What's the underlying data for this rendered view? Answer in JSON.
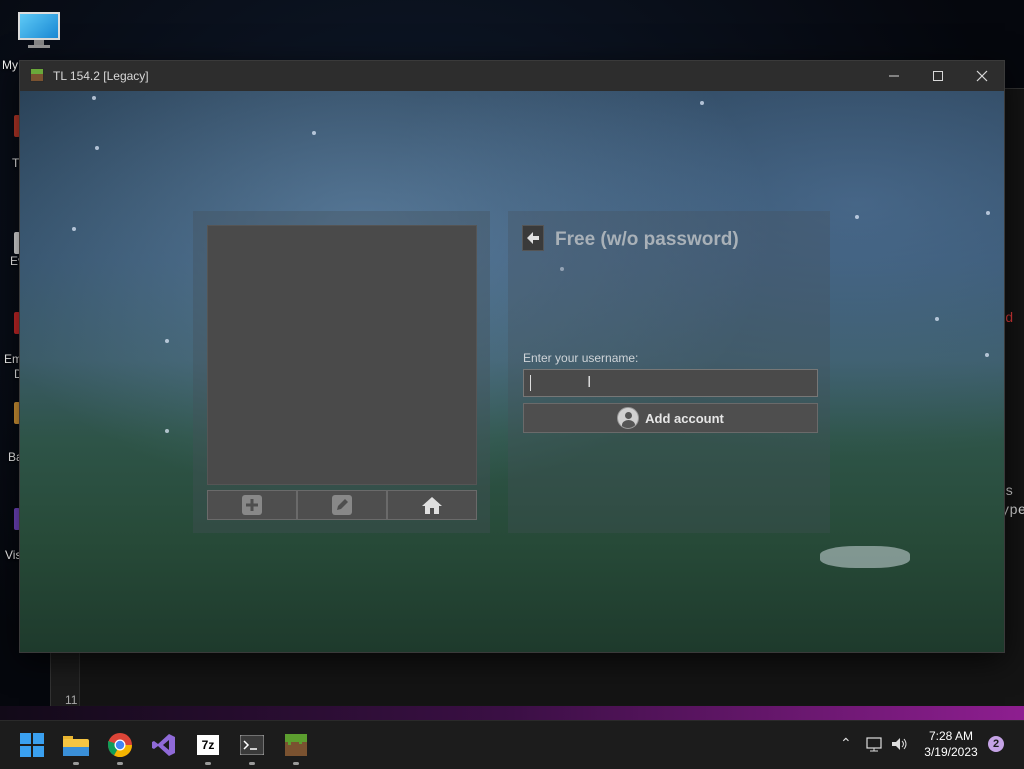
{
  "desktop": {
    "icons": [
      {
        "label": "My"
      },
      {
        "label": "T"
      },
      {
        "label": "Ev"
      },
      {
        "label": "Em"
      },
      {
        "label": "D"
      },
      {
        "label": "Ba"
      },
      {
        "label": "Vis"
      }
    ]
  },
  "background_window": {
    "fragments": [
      "d",
      "s",
      "ype"
    ],
    "line_number": "11"
  },
  "window": {
    "title": "TL 154.2 [Legacy]",
    "controls": {
      "minimize": "minimize",
      "maximize": "maximize",
      "close": "close"
    }
  },
  "account_panel": {
    "toolbar": {
      "add_icon": "plus-icon",
      "edit_icon": "pencil-icon",
      "home_icon": "home-icon"
    }
  },
  "login_form": {
    "title": "Free (w/o password)",
    "username_label": "Enter your username:",
    "username_value": "",
    "add_account_label": "Add account"
  },
  "taskbar": {
    "apps": [
      "start",
      "file-explorer",
      "chrome",
      "visual-studio",
      "7zip",
      "terminal",
      "tlauncher"
    ],
    "labels": {
      "7zip": "7z"
    },
    "clock_time": "7:28 AM",
    "clock_date": "3/19/2023",
    "notification_count": "2"
  },
  "colors": {
    "accent_red": "#e23b3b",
    "title_text": "#a9b1b8",
    "notification": "#c5a3e6"
  }
}
